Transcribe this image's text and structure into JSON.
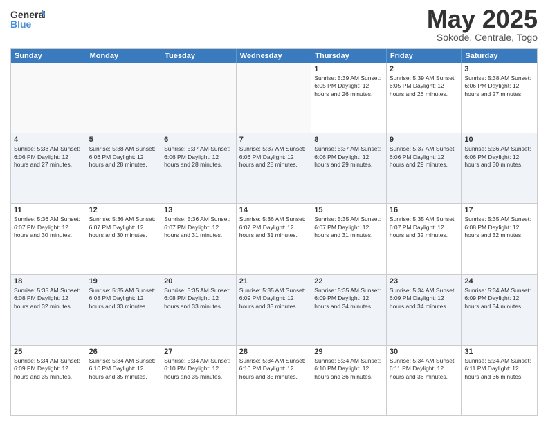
{
  "logo": {
    "general": "General",
    "blue": "Blue"
  },
  "title": "May 2025",
  "subtitle": "Sokode, Centrale, Togo",
  "days": [
    "Sunday",
    "Monday",
    "Tuesday",
    "Wednesday",
    "Thursday",
    "Friday",
    "Saturday"
  ],
  "weeks": [
    [
      {
        "day": "",
        "info": ""
      },
      {
        "day": "",
        "info": ""
      },
      {
        "day": "",
        "info": ""
      },
      {
        "day": "",
        "info": ""
      },
      {
        "day": "1",
        "info": "Sunrise: 5:39 AM\nSunset: 6:05 PM\nDaylight: 12 hours\nand 26 minutes."
      },
      {
        "day": "2",
        "info": "Sunrise: 5:39 AM\nSunset: 6:05 PM\nDaylight: 12 hours\nand 26 minutes."
      },
      {
        "day": "3",
        "info": "Sunrise: 5:38 AM\nSunset: 6:06 PM\nDaylight: 12 hours\nand 27 minutes."
      }
    ],
    [
      {
        "day": "4",
        "info": "Sunrise: 5:38 AM\nSunset: 6:06 PM\nDaylight: 12 hours\nand 27 minutes."
      },
      {
        "day": "5",
        "info": "Sunrise: 5:38 AM\nSunset: 6:06 PM\nDaylight: 12 hours\nand 28 minutes."
      },
      {
        "day": "6",
        "info": "Sunrise: 5:37 AM\nSunset: 6:06 PM\nDaylight: 12 hours\nand 28 minutes."
      },
      {
        "day": "7",
        "info": "Sunrise: 5:37 AM\nSunset: 6:06 PM\nDaylight: 12 hours\nand 28 minutes."
      },
      {
        "day": "8",
        "info": "Sunrise: 5:37 AM\nSunset: 6:06 PM\nDaylight: 12 hours\nand 29 minutes."
      },
      {
        "day": "9",
        "info": "Sunrise: 5:37 AM\nSunset: 6:06 PM\nDaylight: 12 hours\nand 29 minutes."
      },
      {
        "day": "10",
        "info": "Sunrise: 5:36 AM\nSunset: 6:06 PM\nDaylight: 12 hours\nand 30 minutes."
      }
    ],
    [
      {
        "day": "11",
        "info": "Sunrise: 5:36 AM\nSunset: 6:07 PM\nDaylight: 12 hours\nand 30 minutes."
      },
      {
        "day": "12",
        "info": "Sunrise: 5:36 AM\nSunset: 6:07 PM\nDaylight: 12 hours\nand 30 minutes."
      },
      {
        "day": "13",
        "info": "Sunrise: 5:36 AM\nSunset: 6:07 PM\nDaylight: 12 hours\nand 31 minutes."
      },
      {
        "day": "14",
        "info": "Sunrise: 5:36 AM\nSunset: 6:07 PM\nDaylight: 12 hours\nand 31 minutes."
      },
      {
        "day": "15",
        "info": "Sunrise: 5:35 AM\nSunset: 6:07 PM\nDaylight: 12 hours\nand 31 minutes."
      },
      {
        "day": "16",
        "info": "Sunrise: 5:35 AM\nSunset: 6:07 PM\nDaylight: 12 hours\nand 32 minutes."
      },
      {
        "day": "17",
        "info": "Sunrise: 5:35 AM\nSunset: 6:08 PM\nDaylight: 12 hours\nand 32 minutes."
      }
    ],
    [
      {
        "day": "18",
        "info": "Sunrise: 5:35 AM\nSunset: 6:08 PM\nDaylight: 12 hours\nand 32 minutes."
      },
      {
        "day": "19",
        "info": "Sunrise: 5:35 AM\nSunset: 6:08 PM\nDaylight: 12 hours\nand 33 minutes."
      },
      {
        "day": "20",
        "info": "Sunrise: 5:35 AM\nSunset: 6:08 PM\nDaylight: 12 hours\nand 33 minutes."
      },
      {
        "day": "21",
        "info": "Sunrise: 5:35 AM\nSunset: 6:09 PM\nDaylight: 12 hours\nand 33 minutes."
      },
      {
        "day": "22",
        "info": "Sunrise: 5:35 AM\nSunset: 6:09 PM\nDaylight: 12 hours\nand 34 minutes."
      },
      {
        "day": "23",
        "info": "Sunrise: 5:34 AM\nSunset: 6:09 PM\nDaylight: 12 hours\nand 34 minutes."
      },
      {
        "day": "24",
        "info": "Sunrise: 5:34 AM\nSunset: 6:09 PM\nDaylight: 12 hours\nand 34 minutes."
      }
    ],
    [
      {
        "day": "25",
        "info": "Sunrise: 5:34 AM\nSunset: 6:09 PM\nDaylight: 12 hours\nand 35 minutes."
      },
      {
        "day": "26",
        "info": "Sunrise: 5:34 AM\nSunset: 6:10 PM\nDaylight: 12 hours\nand 35 minutes."
      },
      {
        "day": "27",
        "info": "Sunrise: 5:34 AM\nSunset: 6:10 PM\nDaylight: 12 hours\nand 35 minutes."
      },
      {
        "day": "28",
        "info": "Sunrise: 5:34 AM\nSunset: 6:10 PM\nDaylight: 12 hours\nand 35 minutes."
      },
      {
        "day": "29",
        "info": "Sunrise: 5:34 AM\nSunset: 6:10 PM\nDaylight: 12 hours\nand 36 minutes."
      },
      {
        "day": "30",
        "info": "Sunrise: 5:34 AM\nSunset: 6:11 PM\nDaylight: 12 hours\nand 36 minutes."
      },
      {
        "day": "31",
        "info": "Sunrise: 5:34 AM\nSunset: 6:11 PM\nDaylight: 12 hours\nand 36 minutes."
      }
    ]
  ]
}
